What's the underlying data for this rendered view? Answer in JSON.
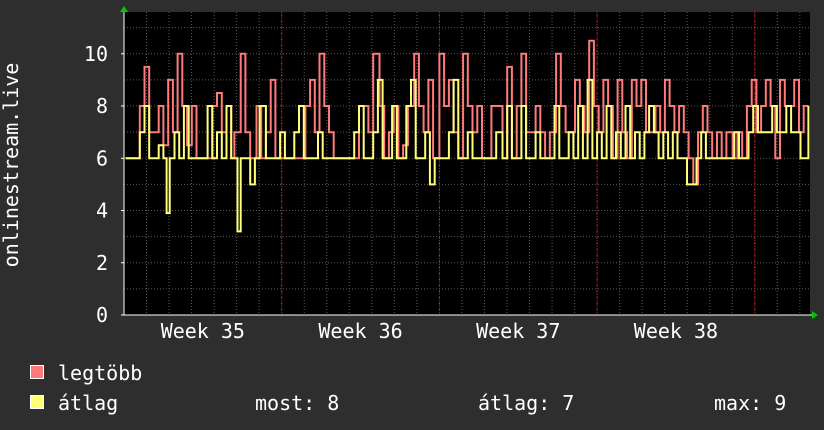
{
  "colors": {
    "background": "#2e2e2e",
    "plot_background": "#000000",
    "grid": "#5a5a5a",
    "week_lines": "#8a2a2a",
    "text": "#ffffff",
    "axis_arrow": "#00c800",
    "max_series": "#ff7a7a",
    "avg_series": "#ffff7a"
  },
  "chart_data": {
    "type": "line",
    "title": "",
    "xlabel": "",
    "ylabel": "onlinestream.live",
    "ylim": [
      0,
      11.6
    ],
    "yticks": [
      0,
      2,
      4,
      6,
      8,
      10
    ],
    "xlim": [
      34.5,
      38.85
    ],
    "xticks": [
      {
        "label": "Week 35",
        "x": 35
      },
      {
        "label": "Week 36",
        "x": 36
      },
      {
        "label": "Week 37",
        "x": 37
      },
      {
        "label": "Week 38",
        "x": 38
      }
    ],
    "grid": true,
    "legend_placement": "bottom",
    "series": [
      {
        "name": "legtöbb",
        "color": "#ff7a7a",
        "points": [
          [
            34.51,
            6
          ],
          [
            34.57,
            6
          ],
          [
            34.6,
            8
          ],
          [
            34.63,
            9.5
          ],
          [
            34.66,
            7
          ],
          [
            34.69,
            7
          ],
          [
            34.72,
            8
          ],
          [
            34.75,
            6.5
          ],
          [
            34.78,
            9
          ],
          [
            34.81,
            7
          ],
          [
            34.84,
            10
          ],
          [
            34.87,
            8
          ],
          [
            34.9,
            6.5
          ],
          [
            34.93,
            8
          ],
          [
            34.96,
            6
          ],
          [
            35.0,
            6
          ],
          [
            35.03,
            6
          ],
          [
            35.06,
            8
          ],
          [
            35.09,
            8.5
          ],
          [
            35.12,
            7
          ],
          [
            35.15,
            8
          ],
          [
            35.18,
            6
          ],
          [
            35.2,
            7
          ],
          [
            35.24,
            10
          ],
          [
            35.27,
            7
          ],
          [
            35.3,
            6
          ],
          [
            35.34,
            8
          ],
          [
            35.37,
            6
          ],
          [
            35.4,
            7
          ],
          [
            35.43,
            9
          ],
          [
            35.46,
            6
          ],
          [
            35.5,
            6
          ],
          [
            35.53,
            6
          ],
          [
            35.56,
            6
          ],
          [
            35.59,
            6
          ],
          [
            35.62,
            6
          ],
          [
            35.65,
            8
          ],
          [
            35.68,
            9
          ],
          [
            35.71,
            7
          ],
          [
            35.74,
            10
          ],
          [
            35.77,
            8
          ],
          [
            35.8,
            7
          ],
          [
            35.83,
            6
          ],
          [
            35.86,
            6
          ],
          [
            35.9,
            6
          ],
          [
            35.93,
            6
          ],
          [
            35.96,
            6
          ],
          [
            35.99,
            8
          ],
          [
            36.02,
            8
          ],
          [
            36.05,
            7
          ],
          [
            36.08,
            10
          ],
          [
            36.12,
            8
          ],
          [
            36.15,
            6
          ],
          [
            36.18,
            7
          ],
          [
            36.21,
            8
          ],
          [
            36.24,
            6
          ],
          [
            36.27,
            6.5
          ],
          [
            36.3,
            8
          ],
          [
            36.34,
            10
          ],
          [
            36.37,
            8
          ],
          [
            36.4,
            7
          ],
          [
            36.43,
            9
          ],
          [
            36.46,
            6
          ],
          [
            36.5,
            10
          ],
          [
            36.53,
            8
          ],
          [
            36.56,
            9
          ],
          [
            36.59,
            7
          ],
          [
            36.62,
            6
          ],
          [
            36.65,
            10
          ],
          [
            36.68,
            8
          ],
          [
            36.71,
            7
          ],
          [
            36.74,
            8
          ],
          [
            36.77,
            6
          ],
          [
            36.8,
            6
          ],
          [
            36.83,
            8
          ],
          [
            36.86,
            8
          ],
          [
            36.9,
            6
          ],
          [
            36.93,
            9.5
          ],
          [
            36.96,
            6
          ],
          [
            36.99,
            8
          ],
          [
            37.02,
            10
          ],
          [
            37.05,
            7
          ],
          [
            37.08,
            7
          ],
          [
            37.11,
            8
          ],
          [
            37.14,
            7
          ],
          [
            37.17,
            6
          ],
          [
            37.2,
            7
          ],
          [
            37.24,
            10
          ],
          [
            37.27,
            8
          ],
          [
            37.3,
            7
          ],
          [
            37.33,
            7
          ],
          [
            37.36,
            9
          ],
          [
            37.39,
            8
          ],
          [
            37.42,
            7
          ],
          [
            37.45,
            10.5
          ],
          [
            37.48,
            8
          ],
          [
            37.51,
            7
          ],
          [
            37.54,
            9
          ],
          [
            37.57,
            8
          ],
          [
            37.6,
            6
          ],
          [
            37.63,
            9
          ],
          [
            37.66,
            7
          ],
          [
            37.69,
            6
          ],
          [
            37.72,
            9
          ],
          [
            37.75,
            8
          ],
          [
            37.78,
            9
          ],
          [
            37.81,
            7
          ],
          [
            37.84,
            7
          ],
          [
            37.87,
            8
          ],
          [
            37.9,
            7
          ],
          [
            37.93,
            9
          ],
          [
            37.96,
            8
          ],
          [
            37.99,
            7
          ],
          [
            38.02,
            8
          ],
          [
            38.05,
            7
          ],
          [
            38.08,
            6
          ],
          [
            38.11,
            5
          ],
          [
            38.14,
            7
          ],
          [
            38.17,
            8
          ],
          [
            38.2,
            7
          ],
          [
            38.23,
            6
          ],
          [
            38.26,
            7
          ],
          [
            38.29,
            6
          ],
          [
            38.32,
            7
          ],
          [
            38.36,
            6
          ],
          [
            38.39,
            7
          ],
          [
            38.42,
            6
          ],
          [
            38.45,
            8
          ],
          [
            38.48,
            9
          ],
          [
            38.51,
            7
          ],
          [
            38.54,
            8
          ],
          [
            38.57,
            9
          ],
          [
            38.6,
            8
          ],
          [
            38.63,
            6
          ],
          [
            38.66,
            9
          ],
          [
            38.69,
            8
          ],
          [
            38.72,
            8
          ],
          [
            38.75,
            9
          ],
          [
            38.78,
            7
          ],
          [
            38.81,
            8
          ],
          [
            38.84,
            8
          ]
        ]
      },
      {
        "name": "átlag",
        "color": "#ffff7a",
        "points": [
          [
            34.51,
            6
          ],
          [
            34.57,
            6
          ],
          [
            34.6,
            7
          ],
          [
            34.63,
            8
          ],
          [
            34.66,
            6
          ],
          [
            34.69,
            6
          ],
          [
            34.72,
            6.5
          ],
          [
            34.75,
            6
          ],
          [
            34.77,
            3.9
          ],
          [
            34.79,
            6
          ],
          [
            34.82,
            7
          ],
          [
            34.85,
            6
          ],
          [
            34.88,
            8
          ],
          [
            34.91,
            6
          ],
          [
            34.94,
            6
          ],
          [
            34.97,
            6
          ],
          [
            35.0,
            6
          ],
          [
            35.03,
            8
          ],
          [
            35.06,
            6
          ],
          [
            35.09,
            7
          ],
          [
            35.12,
            6
          ],
          [
            35.15,
            8
          ],
          [
            35.18,
            6
          ],
          [
            35.2,
            6
          ],
          [
            35.22,
            3.2
          ],
          [
            35.24,
            6
          ],
          [
            35.27,
            6
          ],
          [
            35.3,
            5
          ],
          [
            35.33,
            6
          ],
          [
            35.36,
            8
          ],
          [
            35.4,
            6
          ],
          [
            35.43,
            6
          ],
          [
            35.46,
            6
          ],
          [
            35.49,
            7
          ],
          [
            35.52,
            6
          ],
          [
            35.55,
            6
          ],
          [
            35.58,
            7
          ],
          [
            35.61,
            8
          ],
          [
            35.64,
            6
          ],
          [
            35.67,
            6
          ],
          [
            35.7,
            6
          ],
          [
            35.73,
            7
          ],
          [
            35.76,
            6
          ],
          [
            35.8,
            6
          ],
          [
            35.83,
            6
          ],
          [
            35.86,
            6
          ],
          [
            35.9,
            6
          ],
          [
            35.93,
            6
          ],
          [
            35.96,
            7
          ],
          [
            35.99,
            8
          ],
          [
            36.02,
            6
          ],
          [
            36.05,
            6
          ],
          [
            36.08,
            7
          ],
          [
            36.11,
            9
          ],
          [
            36.14,
            6
          ],
          [
            36.17,
            6
          ],
          [
            36.2,
            8
          ],
          [
            36.23,
            6
          ],
          [
            36.26,
            6
          ],
          [
            36.29,
            8
          ],
          [
            36.32,
            9
          ],
          [
            36.35,
            6
          ],
          [
            36.38,
            6
          ],
          [
            36.41,
            7
          ],
          [
            36.44,
            5
          ],
          [
            36.47,
            6
          ],
          [
            36.5,
            6
          ],
          [
            36.53,
            6
          ],
          [
            36.56,
            7
          ],
          [
            36.59,
            9
          ],
          [
            36.62,
            6
          ],
          [
            36.65,
            6
          ],
          [
            36.68,
            7
          ],
          [
            36.71,
            6
          ],
          [
            36.74,
            6
          ],
          [
            36.77,
            6
          ],
          [
            36.8,
            6
          ],
          [
            36.83,
            6
          ],
          [
            36.86,
            7
          ],
          [
            36.9,
            6
          ],
          [
            36.93,
            8
          ],
          [
            36.96,
            6
          ],
          [
            36.99,
            6
          ],
          [
            37.02,
            8
          ],
          [
            37.05,
            6
          ],
          [
            37.08,
            6
          ],
          [
            37.11,
            7
          ],
          [
            37.14,
            6
          ],
          [
            37.17,
            6
          ],
          [
            37.2,
            6
          ],
          [
            37.23,
            8
          ],
          [
            37.26,
            6
          ],
          [
            37.29,
            6
          ],
          [
            37.32,
            7
          ],
          [
            37.35,
            6
          ],
          [
            37.38,
            8
          ],
          [
            37.41,
            6
          ],
          [
            37.44,
            9
          ],
          [
            37.47,
            6
          ],
          [
            37.5,
            7
          ],
          [
            37.53,
            6
          ],
          [
            37.56,
            8
          ],
          [
            37.59,
            6
          ],
          [
            37.62,
            7
          ],
          [
            37.65,
            6
          ],
          [
            37.68,
            8
          ],
          [
            37.71,
            6
          ],
          [
            37.74,
            7
          ],
          [
            37.77,
            6
          ],
          [
            37.8,
            7
          ],
          [
            37.83,
            8
          ],
          [
            37.86,
            7
          ],
          [
            37.89,
            6
          ],
          [
            37.92,
            7
          ],
          [
            37.95,
            6
          ],
          [
            37.98,
            7
          ],
          [
            38.01,
            6
          ],
          [
            38.04,
            6
          ],
          [
            38.07,
            5
          ],
          [
            38.1,
            5
          ],
          [
            38.13,
            6
          ],
          [
            38.16,
            7
          ],
          [
            38.19,
            6
          ],
          [
            38.22,
            6
          ],
          [
            38.25,
            6
          ],
          [
            38.28,
            6
          ],
          [
            38.31,
            6
          ],
          [
            38.34,
            6
          ],
          [
            38.37,
            7
          ],
          [
            38.4,
            6
          ],
          [
            38.43,
            6
          ],
          [
            38.46,
            7
          ],
          [
            38.49,
            8
          ],
          [
            38.52,
            7
          ],
          [
            38.55,
            7
          ],
          [
            38.58,
            7
          ],
          [
            38.61,
            8
          ],
          [
            38.64,
            7
          ],
          [
            38.67,
            7
          ],
          [
            38.7,
            8
          ],
          [
            38.73,
            7
          ],
          [
            38.76,
            7
          ],
          [
            38.79,
            6
          ],
          [
            38.82,
            6
          ],
          [
            38.84,
            8
          ]
        ]
      }
    ]
  },
  "legend": {
    "items": [
      {
        "label": "legtöbb",
        "color": "#ff7a7a"
      },
      {
        "label": "átlag",
        "color": "#ffff7a"
      }
    ],
    "stats": {
      "most": "most: 8",
      "atlag": "átlag: 7",
      "max": "max: 9"
    }
  }
}
